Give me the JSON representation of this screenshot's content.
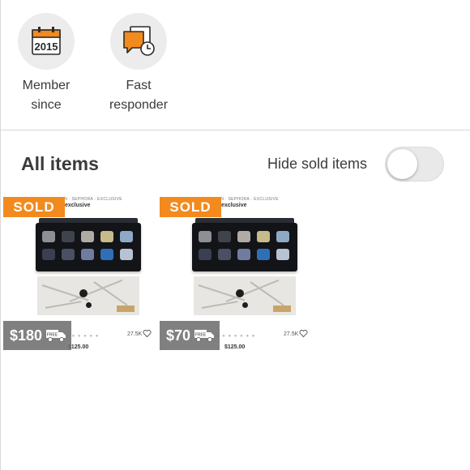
{
  "badges": [
    {
      "icon": "calendar-icon",
      "year": "2015",
      "line1": "Member",
      "line2": "since"
    },
    {
      "icon": "chat-clock-icon",
      "line1": "Fast",
      "line2": "responder"
    }
  ],
  "section": {
    "title": "All items",
    "hide_sold_label": "Hide sold items",
    "hide_sold_enabled": false
  },
  "listings": [
    {
      "status": "SOLD",
      "price": "$180",
      "shipping_badge": "FREE",
      "thumb": {
        "header": "BOBBI BROWN  ·  SEPHORA  ·  EXCLUSIVE",
        "subtitle": "exclusive",
        "likes": "27.5K",
        "price": "$125.00"
      }
    },
    {
      "status": "SOLD",
      "price": "$70",
      "shipping_badge": "FREE",
      "thumb": {
        "header": "BOBBI BROWN  ·  SEPHORA  ·  EXCLUSIVE",
        "subtitle": "exclusive",
        "likes": "27.5K",
        "price": "$125.00"
      }
    }
  ],
  "colors": {
    "accent": "#f28a1e",
    "badge_bg": "#ececec",
    "price_tag_bg": "#6e6e6e"
  }
}
